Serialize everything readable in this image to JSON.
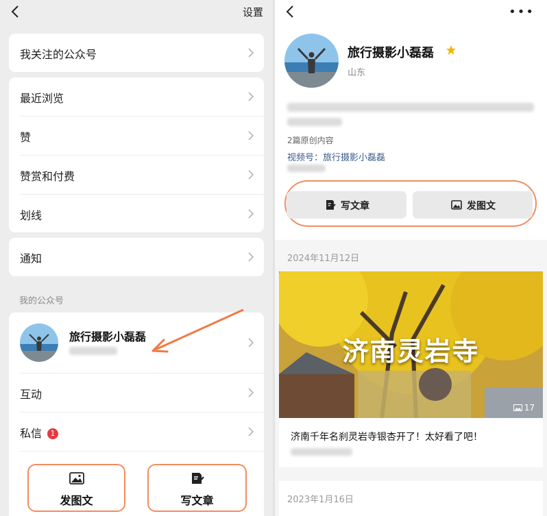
{
  "left": {
    "settings_label": "设置",
    "menu": {
      "followed": "我关注的公众号",
      "recent": "最近浏览",
      "likes": "赞",
      "rewards": "赞赏和付费",
      "underline": "划线",
      "notify": "通知"
    },
    "section_title": "我的公众号",
    "account_name": "旅行摄影小磊磊",
    "interact_label": "互动",
    "messages_label": "私信",
    "messages_badge": "1",
    "actions": {
      "post_images": "发图文",
      "write_article": "写文章"
    }
  },
  "right": {
    "profile_name": "旅行摄影小磊磊",
    "location": "山东",
    "original_count": "2篇原创内容",
    "video_account": "视频号：旅行摄影小磊磊",
    "buttons": {
      "write_article": "写文章",
      "post_images": "发图文"
    },
    "post1": {
      "date": "2024年11月12日",
      "image_title": "济南灵岩寺",
      "image_count": "17",
      "title": "济南千年名刹灵岩寺银杏开了！太好看了吧！"
    },
    "post2": {
      "date": "2023年1月16日"
    }
  },
  "colors": {
    "highlight": "#f28c5e",
    "badge": "#e6393e",
    "star": "#f5b800",
    "link": "#3a5a8a"
  },
  "icons": [
    "back-icon",
    "chevron-right-icon",
    "more-icon",
    "image-icon",
    "edit-icon",
    "star-icon",
    "arrow-annotation"
  ]
}
